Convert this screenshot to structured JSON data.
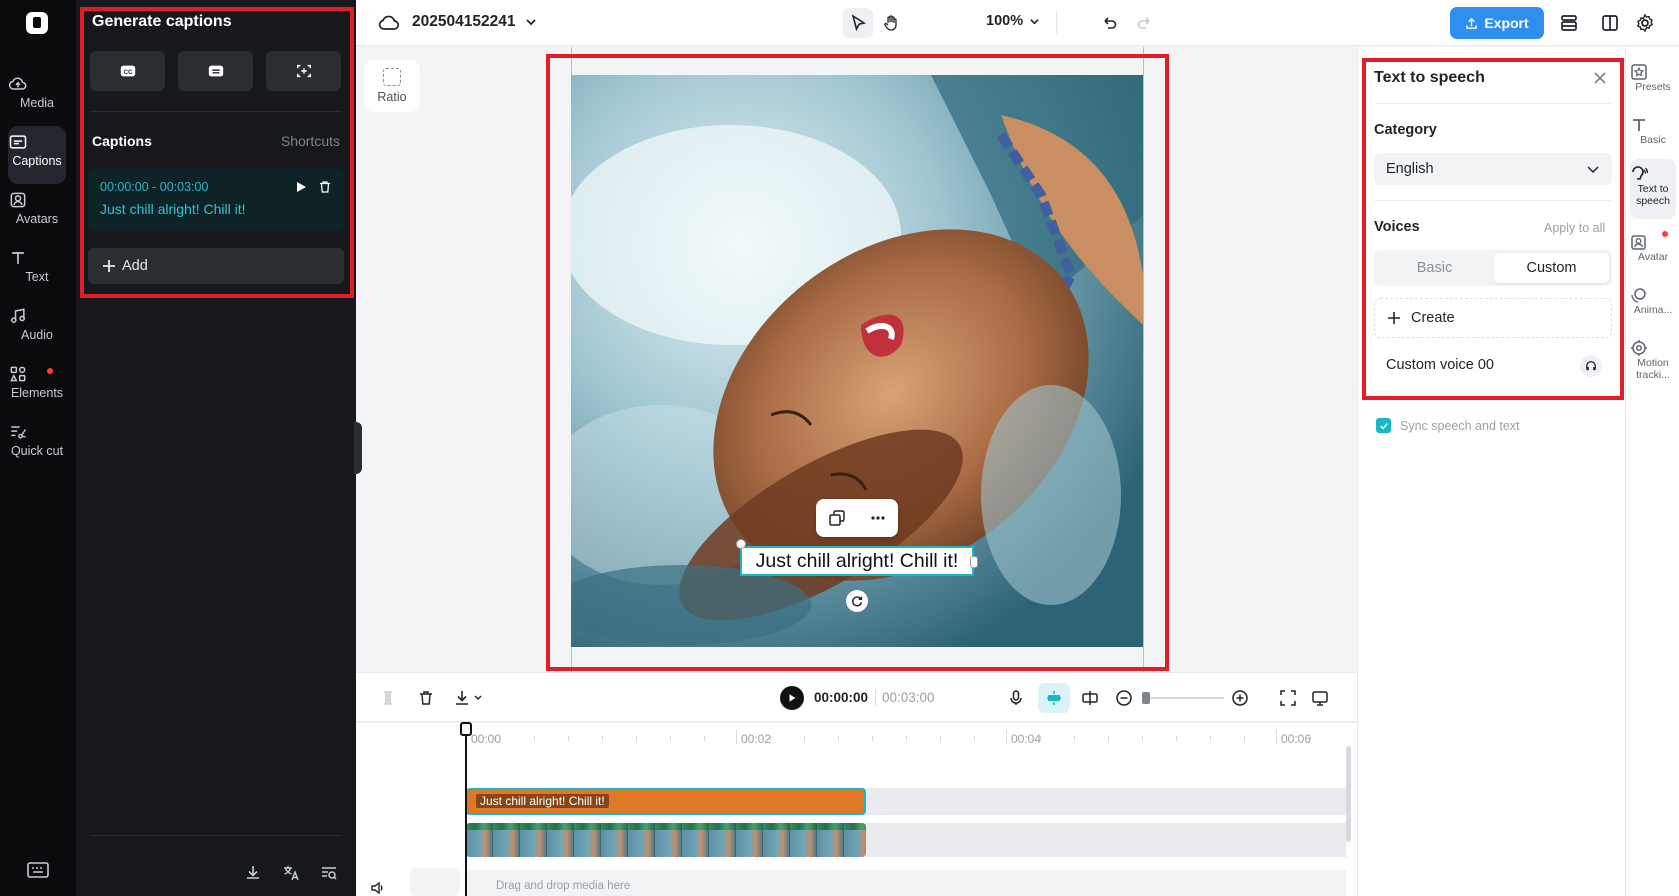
{
  "rail": {
    "items": [
      {
        "label": "Media"
      },
      {
        "label": "Captions"
      },
      {
        "label": "Avatars"
      },
      {
        "label": "Text"
      },
      {
        "label": "Audio"
      },
      {
        "label": "Elements"
      },
      {
        "label": "Quick cut"
      }
    ]
  },
  "left_panel": {
    "title": "Generate captions",
    "captions_heading": "Captions",
    "shortcuts_label": "Shortcuts",
    "caption": {
      "time": "00:00:00 - 00:03:00",
      "text": "Just chill alright! Chill it!"
    },
    "add_label": "Add"
  },
  "topbar": {
    "project_name": "202504152241",
    "zoom": "100%",
    "export_label": "Export"
  },
  "canvas": {
    "ratio_label": "Ratio",
    "caption_text": "Just chill alright! Chill it!"
  },
  "right_panel": {
    "title": "Text to speech",
    "category_label": "Category",
    "category_value": "English",
    "voices_label": "Voices",
    "apply_all": "Apply to all",
    "tabs": [
      {
        "label": "Basic"
      },
      {
        "label": "Custom"
      }
    ],
    "create_label": "Create",
    "voice_name": "Custom voice 00",
    "sync_label": "Sync speech and text"
  },
  "right_rail": {
    "items": [
      {
        "label": "Presets"
      },
      {
        "label": "Basic"
      },
      {
        "label": "Text to speech"
      },
      {
        "label": "Avatar"
      },
      {
        "label": "Anima..."
      },
      {
        "label": "Motion tracki..."
      }
    ]
  },
  "timeline": {
    "current_time": "00:00:00",
    "total_time": "00:03:00",
    "ruler": [
      "00:00",
      "00:02",
      "00:04",
      "00:06"
    ],
    "text_clip_label": "Just chill alright! Chill it!",
    "drop_hint": "Drag and drop media here"
  },
  "colors": {
    "accent": "#18b7c8",
    "export": "#2f8ff0",
    "highlight_box": "#e21d2a",
    "text_clip": "#e0782a"
  }
}
